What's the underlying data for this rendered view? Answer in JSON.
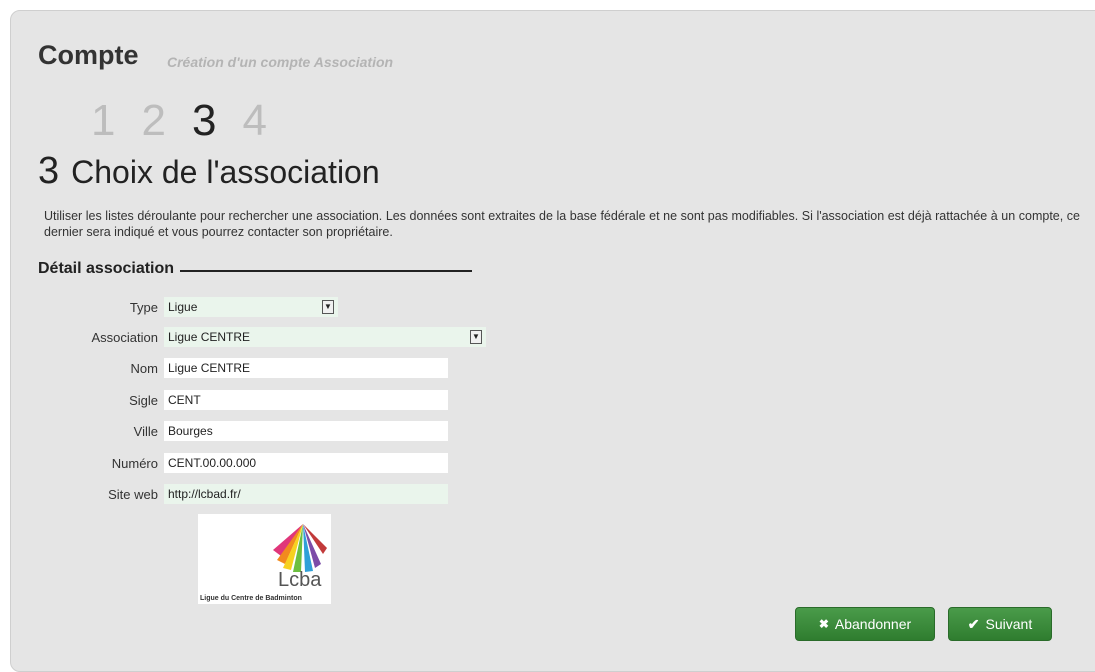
{
  "header": {
    "title": "Compte",
    "subtitle": "Création d'un compte Association"
  },
  "steps": [
    "1",
    "2",
    "3",
    "4"
  ],
  "section": {
    "number": "3",
    "title": "Choix de l'association",
    "intro": "Utiliser les listes déroulante pour rechercher une association. Les données sont extraites de la base fédérale et ne sont pas modifiables. Si l'association est déjà rattachée à un compte, ce dernier sera indiqué et vous pourrez contacter son propriétaire."
  },
  "fieldset": {
    "legend": "Détail association"
  },
  "form": {
    "type_label": "Type",
    "type_value": "Ligue",
    "association_label": "Association",
    "association_value": "Ligue CENTRE",
    "nom_label": "Nom",
    "nom_value": "Ligue CENTRE",
    "sigle_label": "Sigle",
    "sigle_value": "CENT",
    "ville_label": "Ville",
    "ville_value": "Bourges",
    "numero_label": "Numéro",
    "numero_value": "CENT.00.00.000",
    "site_label": "Site web",
    "site_value": "http://lcbad.fr/"
  },
  "logo": {
    "short": "Lcba",
    "caption": "Ligue du Centre de Badminton"
  },
  "buttons": {
    "cancel": "Abandonner",
    "next": "Suivant"
  },
  "colors": {
    "button_green": "#2f7d2f",
    "panel_bg": "#e5e5e5",
    "select_bg": "#eaf5ec"
  }
}
